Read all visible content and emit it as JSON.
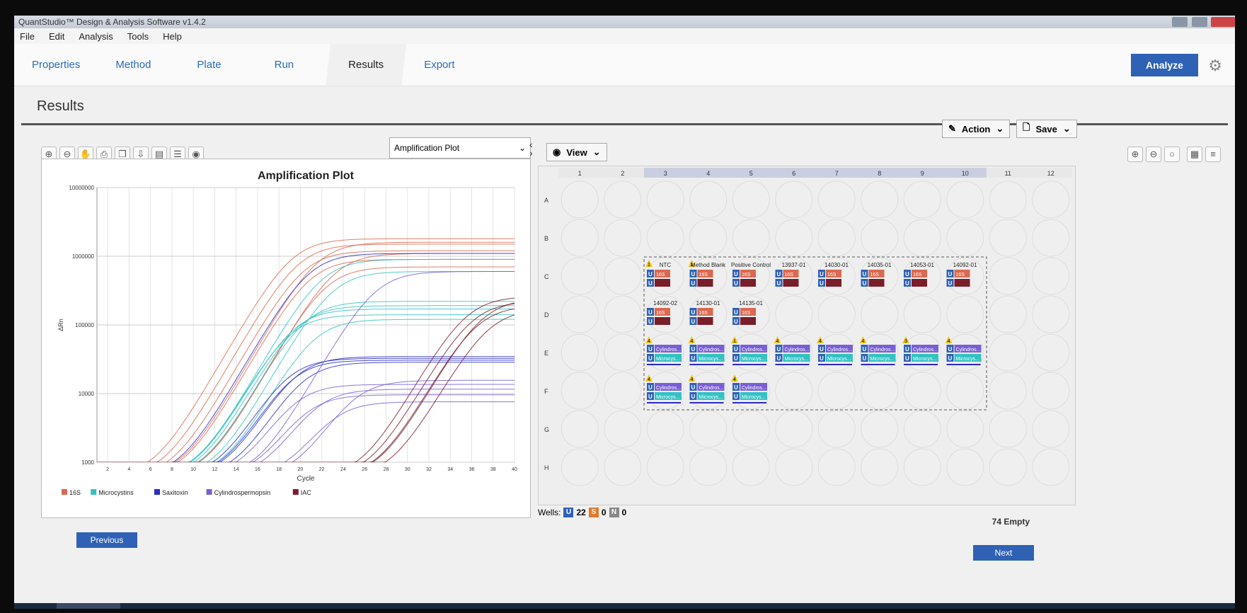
{
  "window": {
    "title": "QuantStudio™ Design & Analysis Software v1.4.2"
  },
  "menu": [
    "File",
    "Edit",
    "Analysis",
    "Tools",
    "Help"
  ],
  "workflow_tabs": [
    "Properties",
    "Method",
    "Plate",
    "Run",
    "Results",
    "Export"
  ],
  "active_tab": "Results",
  "analyze_label": "Analyze",
  "section_title": "Results",
  "action_label": "Action",
  "save_label": "Save",
  "plot_selector": "Amplification Plot",
  "view_label": "View",
  "chart_data": {
    "type": "line",
    "title": "Amplification Plot",
    "xlabel": "Cycle",
    "ylabel": "ΔRn",
    "xlim": [
      1,
      40
    ],
    "ylim": [
      1000,
      10000000
    ],
    "yscale": "log",
    "x_ticks": [
      2,
      4,
      6,
      8,
      10,
      12,
      14,
      16,
      18,
      20,
      22,
      24,
      26,
      28,
      30,
      32,
      34,
      36,
      38,
      40
    ],
    "y_ticks": [
      "1000",
      "10000",
      "100000",
      "1000000",
      "10000000"
    ],
    "legend_position": "bottom",
    "series": [
      {
        "name": "16S",
        "color": "#d9694f",
        "curves": [
          {
            "onset": 14.2,
            "plateau": 1800000
          },
          {
            "onset": 14.8,
            "plateau": 1500000
          },
          {
            "onset": 15.3,
            "plateau": 1200000
          },
          {
            "onset": 15.9,
            "plateau": 900000
          },
          {
            "onset": 16.6,
            "plateau": 1600000
          },
          {
            "onset": 17.4,
            "plateau": 700000
          },
          {
            "onset": 18.2,
            "plateau": 1100000
          }
        ]
      },
      {
        "name": "Microcystins",
        "color": "#33c2c2",
        "curves": [
          {
            "onset": 14.0,
            "plateau": 140000
          },
          {
            "onset": 14.4,
            "plateau": 170000
          },
          {
            "onset": 14.9,
            "plateau": 190000
          },
          {
            "onset": 15.5,
            "plateau": 220000
          },
          {
            "onset": 16.3,
            "plateau": 120000
          },
          {
            "onset": 17.0,
            "plateau": 900000
          },
          {
            "onset": 18.0,
            "plateau": 600000
          }
        ]
      },
      {
        "name": "Saxitoxin",
        "color": "#2b2bc6",
        "curves": [
          {
            "onset": 13.8,
            "plateau": 32000
          },
          {
            "onset": 14.2,
            "plateau": 30000
          },
          {
            "onset": 14.6,
            "plateau": 34000
          },
          {
            "onset": 15.2,
            "plateau": 28000
          },
          {
            "onset": 15.8,
            "plateau": 1100000
          }
        ]
      },
      {
        "name": "Cylindrospermopsin",
        "color": "#7a5ed6",
        "curves": [
          {
            "onset": 14.5,
            "plateau": 13000
          },
          {
            "onset": 15.5,
            "plateau": 9000
          },
          {
            "onset": 16.5,
            "plateau": 11000
          },
          {
            "onset": 18.0,
            "plateau": 7000
          },
          {
            "onset": 20.0,
            "plateau": 15000
          },
          {
            "onset": 22.0,
            "plateau": 600000
          }
        ]
      },
      {
        "name": "IAC",
        "color": "#7a1e2a",
        "curves": [
          {
            "onset": 30.5,
            "plateau": 260000
          },
          {
            "onset": 31.0,
            "plateau": 220000
          },
          {
            "onset": 31.5,
            "plateau": 190000
          },
          {
            "onset": 32.0,
            "plateau": 240000
          },
          {
            "onset": 32.6,
            "plateau": 170000
          }
        ]
      }
    ]
  },
  "plate": {
    "columns": [
      "1",
      "2",
      "3",
      "4",
      "5",
      "6",
      "7",
      "8",
      "9",
      "10",
      "11",
      "12"
    ],
    "rows": [
      "A",
      "B",
      "C",
      "D",
      "E",
      "F",
      "G",
      "H"
    ],
    "wells": [
      {
        "row": "C",
        "col": 3,
        "sample": "NTC",
        "flag": "1",
        "targets": [
          "16S"
        ]
      },
      {
        "row": "C",
        "col": 4,
        "sample": "Method Blank",
        "flag": "1",
        "targets": [
          "16S"
        ]
      },
      {
        "row": "C",
        "col": 5,
        "sample": "Positive Control",
        "targets": [
          "16S"
        ]
      },
      {
        "row": "C",
        "col": 6,
        "sample": "13937-01",
        "targets": [
          "16S"
        ]
      },
      {
        "row": "C",
        "col": 7,
        "sample": "14030-01",
        "targets": [
          "16S"
        ]
      },
      {
        "row": "C",
        "col": 8,
        "sample": "14035-01",
        "targets": [
          "16S"
        ]
      },
      {
        "row": "C",
        "col": 9,
        "sample": "14053-01",
        "targets": [
          "16S"
        ]
      },
      {
        "row": "C",
        "col": 10,
        "sample": "14092-01",
        "targets": [
          "16S"
        ]
      },
      {
        "row": "D",
        "col": 3,
        "sample": "14092-02",
        "targets": [
          "16S"
        ]
      },
      {
        "row": "D",
        "col": 4,
        "sample": "14130-01",
        "targets": [
          "16S"
        ]
      },
      {
        "row": "D",
        "col": 5,
        "sample": "14135-01",
        "targets": [
          "16S"
        ]
      },
      {
        "row": "E",
        "col": 3,
        "flag": "4",
        "targets": [
          "Cylindros...",
          "Microcys..."
        ]
      },
      {
        "row": "E",
        "col": 4,
        "flag": "4",
        "targets": [
          "Cylindros...",
          "Microcys..."
        ]
      },
      {
        "row": "E",
        "col": 5,
        "flag": "1",
        "targets": [
          "Cylindros...",
          "Microcys..."
        ]
      },
      {
        "row": "E",
        "col": 6,
        "flag": "4",
        "targets": [
          "Cylindros...",
          "Microcys..."
        ]
      },
      {
        "row": "E",
        "col": 7,
        "flag": "4",
        "targets": [
          "Cylindros...",
          "Microcys..."
        ]
      },
      {
        "row": "E",
        "col": 8,
        "flag": "4",
        "targets": [
          "Cylindros...",
          "Microcys..."
        ]
      },
      {
        "row": "E",
        "col": 9,
        "flag": "3",
        "targets": [
          "Cylindros...",
          "Microcys..."
        ]
      },
      {
        "row": "E",
        "col": 10,
        "flag": "4",
        "targets": [
          "Cylindros...",
          "Microcys..."
        ]
      },
      {
        "row": "F",
        "col": 3,
        "flag": "4",
        "targets": [
          "Cylindros...",
          "Microcys..."
        ]
      },
      {
        "row": "F",
        "col": 4,
        "flag": "4",
        "targets": [
          "Cylindros...",
          "Microcys..."
        ]
      },
      {
        "row": "F",
        "col": 5,
        "flag": "4",
        "targets": [
          "Cylindros...",
          "Microcys..."
        ]
      }
    ],
    "highlighted_columns": [
      "3",
      "4",
      "5",
      "6",
      "7",
      "8",
      "9",
      "10"
    ]
  },
  "wells_summary": {
    "label": "Wells:",
    "unknown": "22",
    "standard": "0",
    "ntc": "0",
    "u": "U",
    "s": "S",
    "n": "N"
  },
  "empty_label": "74 Empty",
  "previous_label": "Previous",
  "next_label": "Next",
  "toolbar_icons": [
    "zoom-in-icon",
    "zoom-out-icon",
    "pan-hand-icon",
    "print-icon",
    "copy-icon",
    "export-icon",
    "report-icon",
    "legend-icon",
    "eye-icon"
  ]
}
